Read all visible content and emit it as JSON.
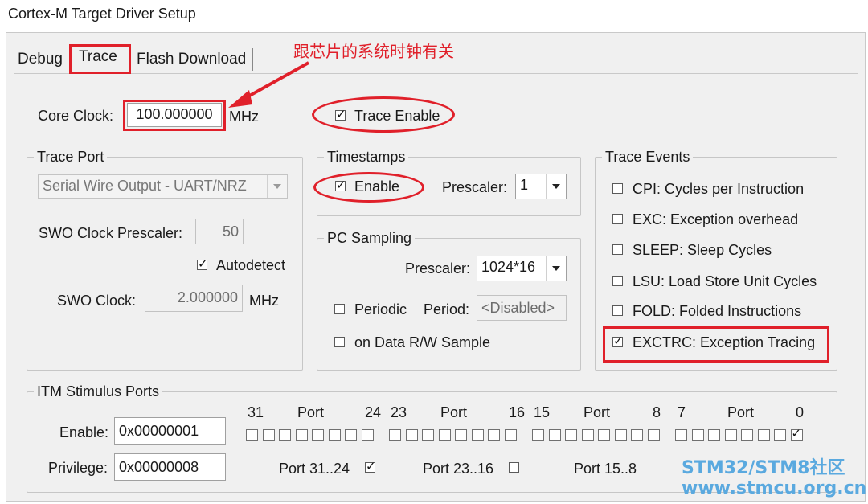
{
  "window": {
    "title": "Cortex-M Target Driver Setup"
  },
  "tabs": [
    {
      "label": "Debug"
    },
    {
      "label": "Trace"
    },
    {
      "label": "Flash Download"
    }
  ],
  "annotation": {
    "text": "跟芯片的系统时钟有关",
    "color": "#e0202a"
  },
  "core_clock": {
    "label": "Core Clock:",
    "value": "100.000000",
    "unit": "MHz"
  },
  "trace_enable": {
    "label": "Trace Enable",
    "checked": true
  },
  "trace_port": {
    "title": "Trace Port",
    "interface": "Serial Wire Output - UART/NRZ",
    "swo_prescaler_label": "SWO Clock Prescaler:",
    "swo_prescaler_value": "50",
    "autodetect_label": "Autodetect",
    "autodetect_checked": true,
    "swo_clock_label": "SWO Clock:",
    "swo_clock_value": "2.000000",
    "swo_clock_unit": "MHz"
  },
  "timestamps": {
    "title": "Timestamps",
    "enable_label": "Enable",
    "enable_checked": true,
    "prescaler_label": "Prescaler:",
    "prescaler_value": "1"
  },
  "pc_sampling": {
    "title": "PC Sampling",
    "prescaler_label": "Prescaler:",
    "prescaler_value": "1024*16",
    "periodic_label": "Periodic",
    "periodic_checked": false,
    "period_label": "Period:",
    "period_value": "<Disabled>",
    "data_rw_label": "on Data R/W Sample",
    "data_rw_checked": false
  },
  "trace_events": {
    "title": "Trace Events",
    "items": [
      {
        "label": "CPI: Cycles per Instruction",
        "checked": false
      },
      {
        "label": "EXC: Exception overhead",
        "checked": false
      },
      {
        "label": "SLEEP: Sleep Cycles",
        "checked": false
      },
      {
        "label": "LSU: Load Store Unit Cycles",
        "checked": false
      },
      {
        "label": "FOLD: Folded Instructions",
        "checked": false
      },
      {
        "label": "EXCTRC: Exception Tracing",
        "checked": true
      }
    ]
  },
  "itm": {
    "title": "ITM Stimulus Ports",
    "enable_label": "Enable:",
    "enable_value": "0x00000001",
    "privilege_label": "Privilege:",
    "privilege_value": "0x00000008",
    "header": [
      "31",
      "Port",
      "24",
      "23",
      "Port",
      "16",
      "15",
      "Port",
      "8",
      "7",
      "Port",
      "0"
    ],
    "port_checked": [
      0
    ],
    "privilege_groups": [
      {
        "label": "Port 31..24",
        "checked": true
      },
      {
        "label": "Port 23..16",
        "checked": false
      },
      {
        "label": "Port 15..8"
      }
    ]
  },
  "watermark": {
    "line1": "STM32/STM8社区",
    "line2": "www.stmcu.org.cn",
    "color": "#5aa9df"
  }
}
